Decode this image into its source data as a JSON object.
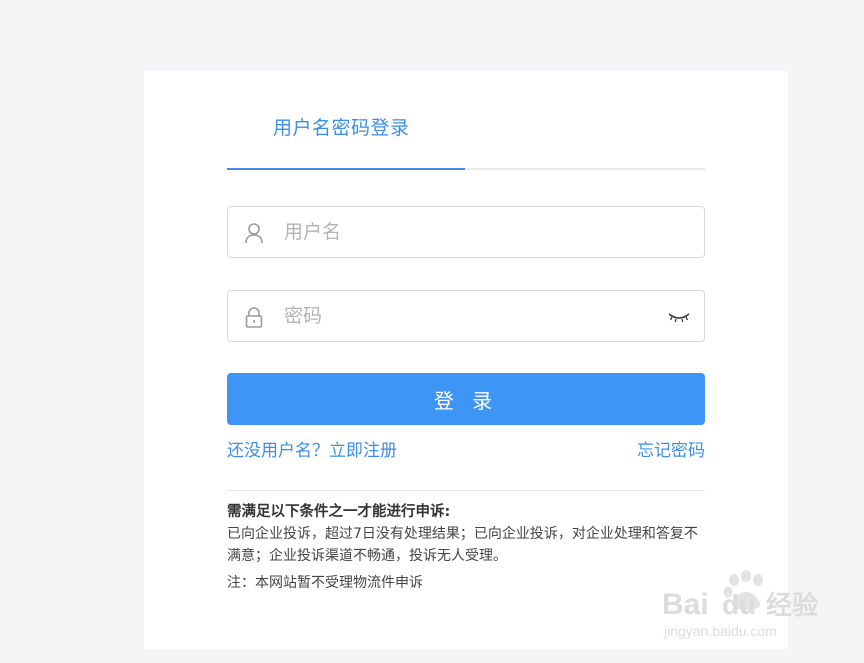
{
  "login": {
    "tab_label": "用户名密码登录",
    "username_placeholder": "用户名",
    "password_placeholder": "密码",
    "submit_label": "登 录",
    "register_link": "还没用户名？立即注册",
    "forgot_link": "忘记密码"
  },
  "notice": {
    "title": "需满足以下条件之一才能进行申诉:",
    "body": "已向企业投诉，超过7日没有处理结果；已向企业投诉，对企业处理和答复不满意；企业投诉渠道不畅通，投诉无人受理。",
    "note": "注：本网站暂不受理物流件申诉"
  },
  "watermark": {
    "brand": "Bai",
    "brand_suffix": "经验",
    "url": "jingyan.baidu.com"
  },
  "icons": {
    "username": "user-icon",
    "password": "lock-icon",
    "toggle": "eye-closed-icon"
  },
  "colors": {
    "accent": "#3b8fe6",
    "button": "#3d95f5",
    "background": "#f4f5f7"
  }
}
